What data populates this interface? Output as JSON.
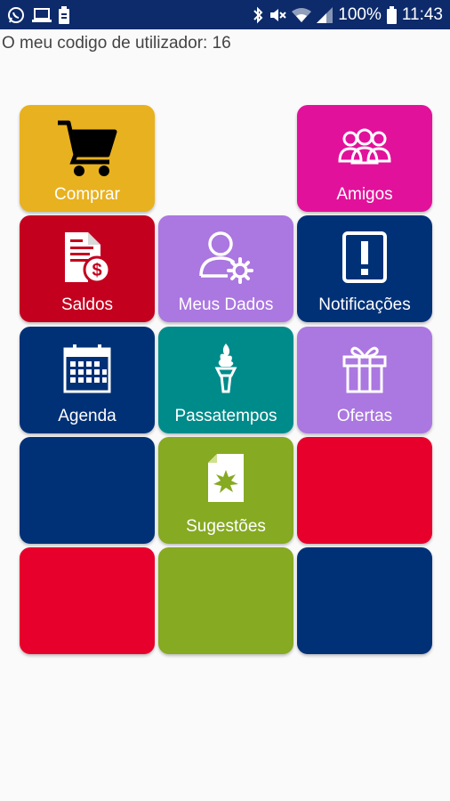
{
  "status_bar": {
    "battery": "100%",
    "time": "11:43",
    "icons": [
      "whatsapp-icon",
      "laptop-icon",
      "battery-saver-icon",
      "bluetooth-icon",
      "mute-icon",
      "wifi-icon",
      "signal-icon",
      "battery-icon"
    ]
  },
  "header": {
    "user_code_text": "O meu codigo de utilizador: 16"
  },
  "tiles": {
    "comprar": {
      "label": "Comprar",
      "color": "#e8b11f",
      "icon": "shopping-cart-icon"
    },
    "amigos": {
      "label": "Amigos",
      "color": "#e2119b",
      "icon": "friends-icon"
    },
    "saldos": {
      "label": "Saldos",
      "color": "#c4001f",
      "icon": "balance-document-icon"
    },
    "meus_dados": {
      "label": "Meus Dados",
      "color": "#ab77e0",
      "icon": "user-settings-icon"
    },
    "notificacoes": {
      "label": "Notificações",
      "color": "#003177",
      "icon": "exclamation-icon"
    },
    "agenda": {
      "label": "Agenda",
      "color": "#003177",
      "icon": "calendar-icon"
    },
    "passatempos": {
      "label": "Passatempos",
      "color": "#008b8b",
      "icon": "torch-icon"
    },
    "ofertas": {
      "label": "Ofertas",
      "color": "#ab77e0",
      "icon": "gift-icon"
    },
    "sugestoes": {
      "label": "Sugestões",
      "color": "#86aa21",
      "icon": "suggestion-document-icon"
    },
    "blank_colors": [
      "#003177",
      "#e8002c",
      "#e8002c",
      "#86aa21",
      "#003177"
    ]
  }
}
